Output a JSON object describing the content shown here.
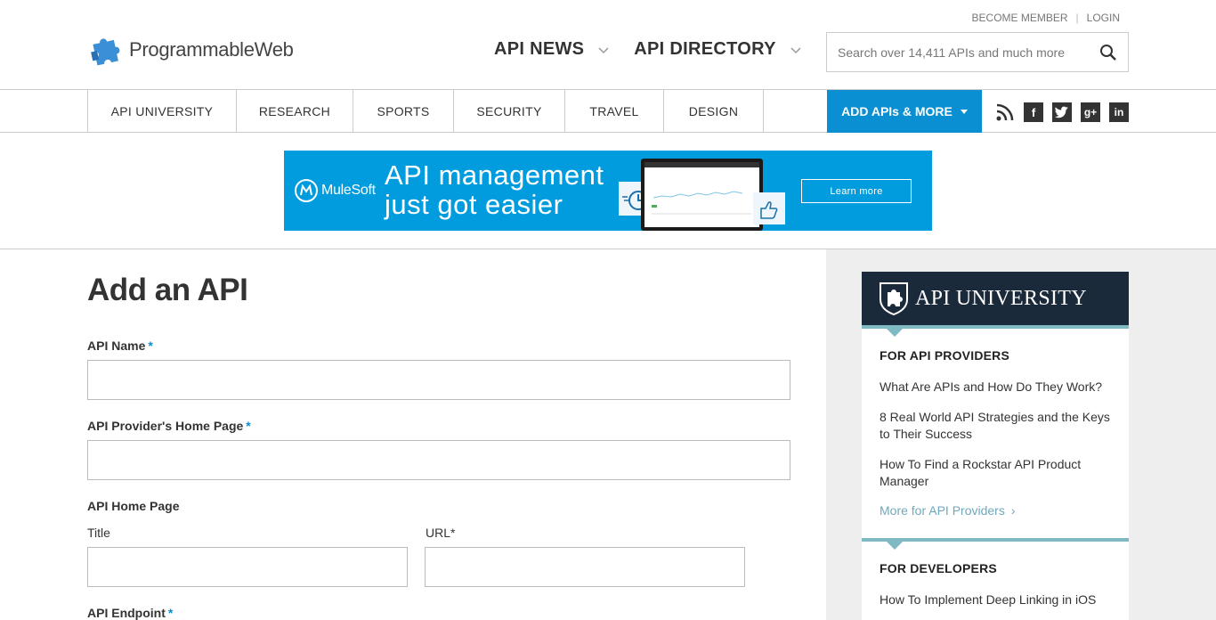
{
  "header": {
    "logo_text": "ProgrammableWeb",
    "top_links": [
      "BECOME MEMBER",
      "LOGIN"
    ],
    "nav": [
      {
        "label": "API NEWS"
      },
      {
        "label": "API DIRECTORY"
      }
    ],
    "search_placeholder": "Search over 14,411 APIs and much more"
  },
  "subnav": {
    "tabs": [
      "API UNIVERSITY",
      "RESEARCH",
      "SPORTS",
      "SECURITY",
      "TRAVEL",
      "DESIGN"
    ],
    "add_button": "ADD APIs & MORE",
    "social": [
      "rss-icon",
      "facebook-icon",
      "twitter-icon",
      "google-plus-icon",
      "linkedin-icon"
    ],
    "accent": "#0a8fd2"
  },
  "banner": {
    "brand": "MuleSoft",
    "headline_line1": "API management",
    "headline_line2": "just got easier",
    "cta": "Learn more",
    "bg": "#009cde"
  },
  "form": {
    "title": "Add an API",
    "required_mark": "*",
    "api_name_label": "API Name",
    "provider_home_label": "API Provider's Home Page",
    "api_home_label": "API Home Page",
    "title_label": "Title",
    "url_label": "URL",
    "endpoint_label": "API Endpoint"
  },
  "sidebar": {
    "title": "API UNIVERSITY",
    "providers_heading": "FOR API PROVIDERS",
    "providers_links": [
      "What Are APIs and How Do They Work?",
      "8 Real World API Strategies and the Keys to Their Success",
      "How To Find a Rockstar API Product Manager"
    ],
    "providers_more": "More for API Providers",
    "developers_heading": "FOR DEVELOPERS",
    "developers_links": [
      "How To Implement Deep Linking in iOS"
    ],
    "header_bg": "#1b2a3a",
    "teal": "#7fb9c1"
  }
}
